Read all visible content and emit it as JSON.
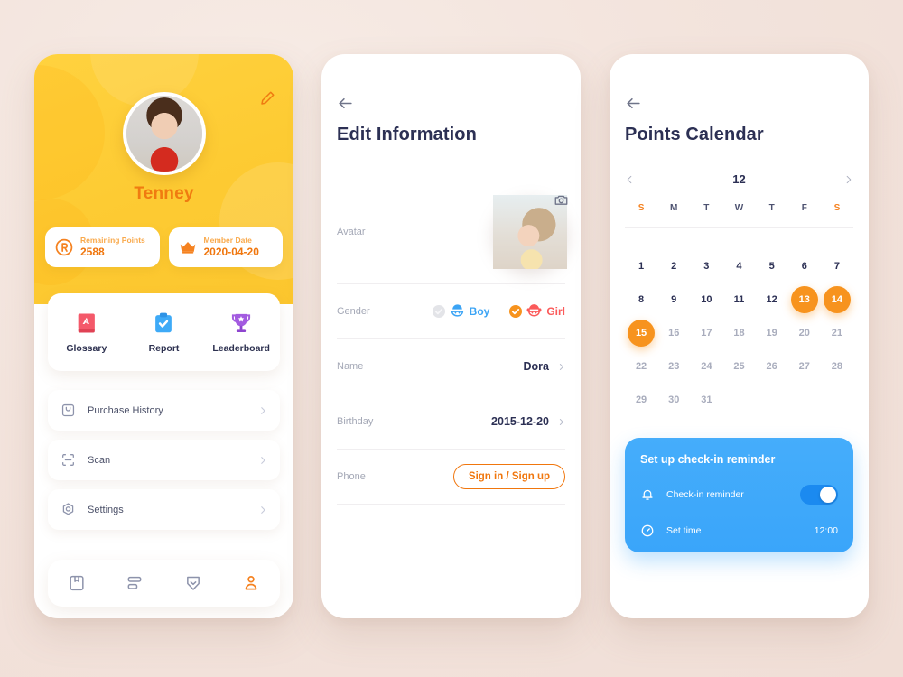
{
  "profile": {
    "name": "Tenney",
    "edit_icon": "pencil-icon",
    "avatar_alt": "boy-avatar",
    "stats": [
      {
        "icon": "points-badge-icon",
        "label": "Remaining Points",
        "value": "2588"
      },
      {
        "icon": "crown-icon",
        "label": "Member Date",
        "value": "2020-04-20"
      }
    ],
    "shortcuts": [
      {
        "icon": "glossary-book-icon",
        "label": "Glossary"
      },
      {
        "icon": "report-clipboard-icon",
        "label": "Report"
      },
      {
        "icon": "leaderboard-trophy-icon",
        "label": "Leaderboard"
      }
    ],
    "menu": [
      {
        "icon": "purchase-bag-icon",
        "label": "Purchase History"
      },
      {
        "icon": "scan-icon",
        "label": "Scan"
      },
      {
        "icon": "settings-gear-icon",
        "label": "Settings"
      }
    ],
    "tabbar": [
      {
        "icon": "bookmark-book-icon",
        "active": false
      },
      {
        "icon": "list-stack-icon",
        "active": false
      },
      {
        "icon": "shield-check-icon",
        "active": false
      },
      {
        "icon": "user-profile-icon",
        "active": true
      }
    ]
  },
  "edit": {
    "back_icon": "back-arrow-icon",
    "title": "Edit Information",
    "avatar_label": "Avatar",
    "camera_icon": "camera-icon",
    "gender": {
      "label": "Gender",
      "options": [
        {
          "label": "Boy",
          "selected": false,
          "color": "#3ba4f5"
        },
        {
          "label": "Girl",
          "selected": true,
          "color": "#fb5a5a"
        }
      ]
    },
    "fields": [
      {
        "label": "Name",
        "value": "Dora"
      },
      {
        "label": "Birthday",
        "value": "2015-12-20"
      }
    ],
    "phone": {
      "label": "Phone",
      "button": "Sign in / Sign up"
    }
  },
  "calendar": {
    "back_icon": "back-arrow-icon",
    "title": "Points Calendar",
    "prev_icon": "chevron-left-icon",
    "next_icon": "chevron-right-icon",
    "month": "12",
    "weekdays": [
      "S",
      "M",
      "T",
      "W",
      "T",
      "F",
      "S"
    ],
    "weekend_indices": [
      0,
      6
    ],
    "days": [
      {
        "n": "1",
        "state": "dark"
      },
      {
        "n": "2",
        "state": "dark"
      },
      {
        "n": "3",
        "state": "dark"
      },
      {
        "n": "4",
        "state": "dark"
      },
      {
        "n": "5",
        "state": "dark"
      },
      {
        "n": "6",
        "state": "dark"
      },
      {
        "n": "7",
        "state": "dark"
      },
      {
        "n": "8",
        "state": "dark"
      },
      {
        "n": "9",
        "state": "dark"
      },
      {
        "n": "10",
        "state": "dark"
      },
      {
        "n": "11",
        "state": "dark"
      },
      {
        "n": "12",
        "state": "dark"
      },
      {
        "n": "13",
        "state": "sel"
      },
      {
        "n": "14",
        "state": "sel"
      },
      {
        "n": "15",
        "state": "sel"
      },
      {
        "n": "16",
        "state": "muted"
      },
      {
        "n": "17",
        "state": "muted"
      },
      {
        "n": "18",
        "state": "muted"
      },
      {
        "n": "19",
        "state": "muted"
      },
      {
        "n": "20",
        "state": "muted"
      },
      {
        "n": "21",
        "state": "muted"
      },
      {
        "n": "22",
        "state": "muted"
      },
      {
        "n": "23",
        "state": "muted"
      },
      {
        "n": "24",
        "state": "muted"
      },
      {
        "n": "25",
        "state": "muted"
      },
      {
        "n": "26",
        "state": "muted"
      },
      {
        "n": "27",
        "state": "muted"
      },
      {
        "n": "28",
        "state": "muted"
      },
      {
        "n": "29",
        "state": "muted"
      },
      {
        "n": "30",
        "state": "muted"
      },
      {
        "n": "31",
        "state": "muted"
      }
    ],
    "reminder": {
      "title": "Set up check-in reminder",
      "rows": [
        {
          "icon": "bell-icon",
          "label": "Check-in reminder",
          "control": "toggle",
          "on": true
        },
        {
          "icon": "clock-icon",
          "label": "Set time",
          "value": "12:00"
        }
      ]
    }
  },
  "colors": {
    "accent_orange": "#f7931e",
    "accent_blue": "#3aa5fa",
    "header_yellow": "#fdcb33",
    "page_bg": "#f2e2da",
    "text_dark": "#2c3054"
  }
}
